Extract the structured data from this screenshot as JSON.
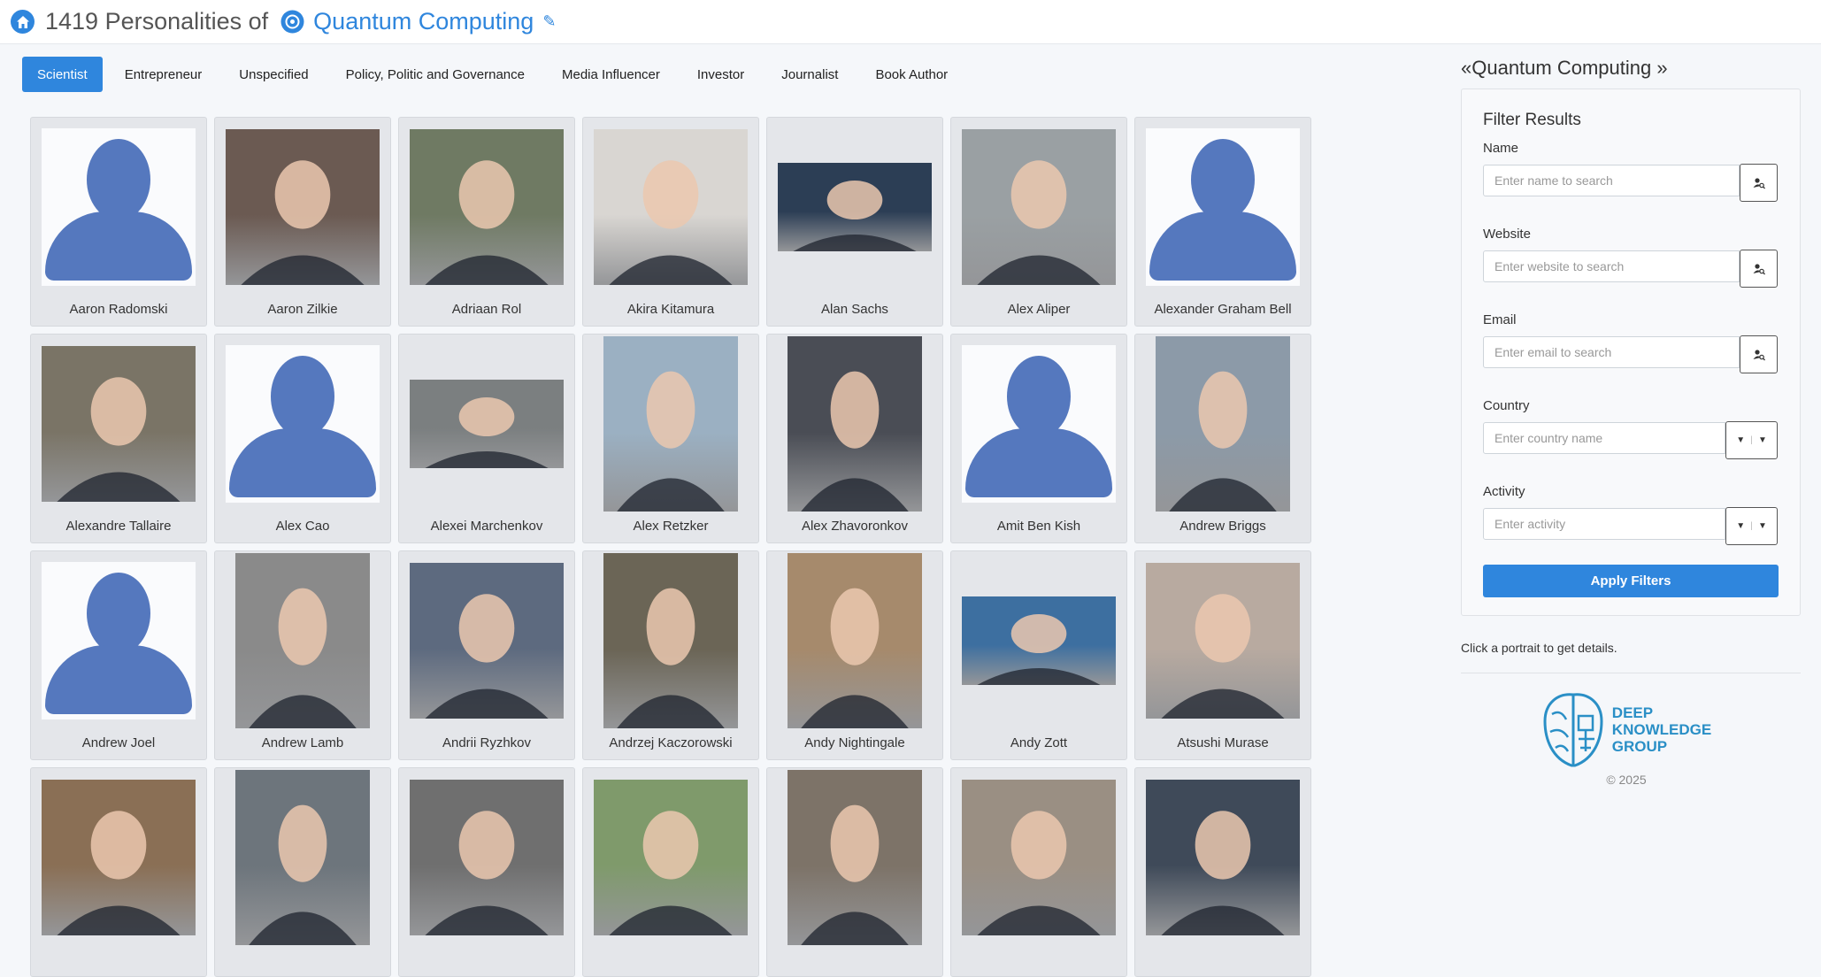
{
  "header": {
    "count_text": "1419 Personalities of",
    "topic": "Quantum Computing"
  },
  "tabs": [
    {
      "label": "Scientist",
      "active": true
    },
    {
      "label": "Entrepreneur"
    },
    {
      "label": "Unspecified"
    },
    {
      "label": "Policy, Politic and Governance"
    },
    {
      "label": "Media Influencer"
    },
    {
      "label": "Investor"
    },
    {
      "label": "Journalist"
    },
    {
      "label": "Book Author"
    }
  ],
  "people": [
    {
      "name": "Aaron Radomski",
      "photo": "placeholder"
    },
    {
      "name": "Aaron Zilkie",
      "photo": "photo",
      "color": "#6b5a52"
    },
    {
      "name": "Adriaan Rol",
      "photo": "photo",
      "color": "#6f7a63"
    },
    {
      "name": "Akira Kitamura",
      "photo": "photo",
      "color": "#d9d6d2"
    },
    {
      "name": "Alan Sachs",
      "photo": "photo-wide",
      "color": "#2c3e55"
    },
    {
      "name": "Alex Aliper",
      "photo": "photo",
      "color": "#9aa0a3"
    },
    {
      "name": "Alexander Graham Bell",
      "photo": "placeholder"
    },
    {
      "name": "Alexandre Tallaire",
      "photo": "photo",
      "color": "#7a7466"
    },
    {
      "name": "Alex Cao",
      "photo": "placeholder"
    },
    {
      "name": "Alexei Marchenkov",
      "photo": "photo-wide",
      "color": "#7b7f80"
    },
    {
      "name": "Alex Retzker",
      "photo": "photo-tall",
      "color": "#9bb0c2"
    },
    {
      "name": "Alex Zhavoronkov",
      "photo": "photo-tall",
      "color": "#4a4d55"
    },
    {
      "name": "Amit Ben Kish",
      "photo": "placeholder"
    },
    {
      "name": "Andrew Briggs",
      "photo": "photo-tall",
      "color": "#8c9aa8"
    },
    {
      "name": "Andrew Joel",
      "photo": "placeholder"
    },
    {
      "name": "Andrew Lamb",
      "photo": "photo-tall",
      "color": "#8a8a8a"
    },
    {
      "name": "Andrii Ryzhkov",
      "photo": "photo",
      "color": "#5d6a7f"
    },
    {
      "name": "Andrzej Kaczorowski",
      "photo": "photo-tall",
      "color": "#6b6556"
    },
    {
      "name": "Andy Nightingale",
      "photo": "photo-tall",
      "color": "#a68a6c"
    },
    {
      "name": "Andy Zott",
      "photo": "photo-wide",
      "color": "#3d6fa0"
    },
    {
      "name": "Atsushi Murase",
      "photo": "photo",
      "color": "#b8aaa0"
    },
    {
      "name": "",
      "photo": "photo",
      "color": "#8a6f55"
    },
    {
      "name": "",
      "photo": "photo-tall",
      "color": "#6d757c"
    },
    {
      "name": "",
      "photo": "photo",
      "color": "#6f6f6f"
    },
    {
      "name": "",
      "photo": "photo",
      "color": "#7f9a6b"
    },
    {
      "name": "",
      "photo": "photo-tall",
      "color": "#7d7368"
    },
    {
      "name": "",
      "photo": "photo",
      "color": "#9a8f83"
    },
    {
      "name": "",
      "photo": "photo",
      "color": "#3f4a59"
    }
  ],
  "sidebar": {
    "title": "«Quantum Computing »",
    "filter_title": "Filter Results",
    "fields": [
      {
        "label": "Name",
        "placeholder": "Enter name to search",
        "kind": "search"
      },
      {
        "label": "Website",
        "placeholder": "Enter website to search",
        "kind": "search"
      },
      {
        "label": "Email",
        "placeholder": "Enter email to search",
        "kind": "search"
      },
      {
        "label": "Country",
        "placeholder": "Enter country name",
        "kind": "select"
      },
      {
        "label": "Activity",
        "placeholder": "Enter activity",
        "kind": "select"
      }
    ],
    "apply_label": "Apply Filters",
    "hint": "Click a portrait to get details.",
    "logo_lines": [
      "DEEP",
      "KNOWLEDGE",
      "GROUP"
    ],
    "copyright": "© 2025"
  }
}
